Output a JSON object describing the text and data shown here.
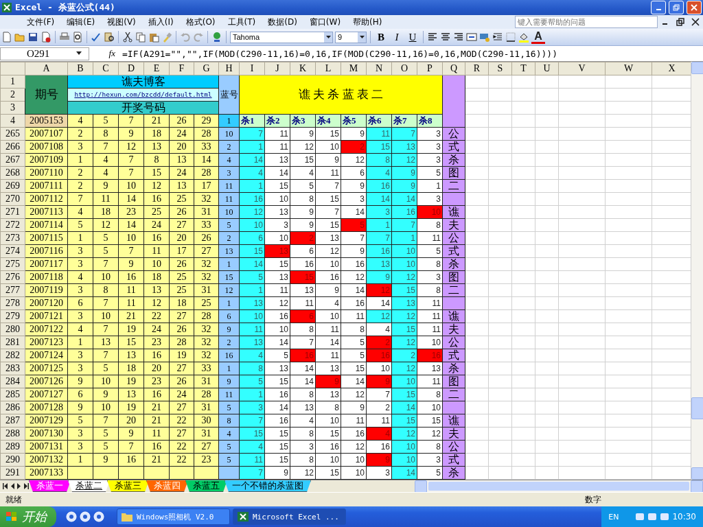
{
  "window": {
    "title": "Excel - 杀蓝公式(44)"
  },
  "menu": [
    "文件(F)",
    "编辑(E)",
    "视图(V)",
    "插入(I)",
    "格式(O)",
    "工具(T)",
    "数据(D)",
    "窗口(W)",
    "帮助(H)"
  ],
  "help_box": {
    "placeholder": "键入需要帮助的问题"
  },
  "toolbar": {
    "font": "Tahoma",
    "size": "9",
    "bold": "B",
    "italic": "I",
    "underline": "U",
    "font_color": "A"
  },
  "formula_bar": {
    "cell": "O291",
    "fx": "fx",
    "formula": "=IF(A291=\"\",\"\",IF(MOD(C290-11,16)=0,16,IF(MOD(C290-11,16)=0,16,MOD(C290-11,16))))"
  },
  "columns": [
    "A",
    "B",
    "C",
    "D",
    "E",
    "F",
    "G",
    "H",
    "I",
    "J",
    "K",
    "L",
    "M",
    "N",
    "O",
    "P",
    "Q",
    "R",
    "S",
    "T",
    "U",
    "V",
    "W",
    "X"
  ],
  "header": {
    "row_labels": [
      "1",
      "2",
      "3",
      "4"
    ],
    "period": "期号",
    "blog": "谯夫博客",
    "link": "http://hexun.com/bzcdd/default.html",
    "draw": "开奖号码",
    "blue": "蓝号",
    "title": "谯 夫 杀 蓝 表 二"
  },
  "row4": {
    "period": "2005153",
    "numbers": [
      "4",
      "5",
      "7",
      "21",
      "26",
      "29"
    ],
    "blue": "1",
    "kills": [
      "杀1",
      "杀2",
      "杀3",
      "杀4",
      "杀5",
      "杀6",
      "杀7",
      "杀8"
    ]
  },
  "rows": [
    {
      "row": "265",
      "period": "2007107",
      "numbers": [
        "2",
        "8",
        "9",
        "18",
        "24",
        "28"
      ],
      "blue": "10",
      "q": "公",
      "kills": [
        {
          "value": "7",
          "color": "#33ffff"
        },
        {
          "value": "11",
          "color": "#ffffff"
        },
        {
          "value": "9",
          "color": "#ffffff"
        },
        {
          "value": "15",
          "color": "#ffffff"
        },
        {
          "value": "9",
          "color": "#ffffff"
        },
        {
          "value": "11",
          "color": "#33ffff"
        },
        {
          "value": "7",
          "color": "#33ffff"
        },
        {
          "value": "3",
          "color": "#ffffff"
        }
      ]
    },
    {
      "row": "266",
      "period": "2007108",
      "numbers": [
        "3",
        "7",
        "12",
        "13",
        "20",
        "33"
      ],
      "blue": "2",
      "q": "式",
      "kills": [
        {
          "value": "1",
          "color": "#33ffff"
        },
        {
          "value": "11",
          "color": "#ffffff"
        },
        {
          "value": "12",
          "color": "#ffffff"
        },
        {
          "value": "10",
          "color": "#ffffff"
        },
        {
          "value": "2",
          "color": "#ff0000"
        },
        {
          "value": "15",
          "color": "#33ffff"
        },
        {
          "value": "13",
          "color": "#33ffff"
        },
        {
          "value": "3",
          "color": "#ffffff"
        }
      ]
    },
    {
      "row": "267",
      "period": "2007109",
      "numbers": [
        "1",
        "4",
        "7",
        "8",
        "13",
        "14"
      ],
      "blue": "4",
      "q": "杀",
      "kills": [
        {
          "value": "14",
          "color": "#33ffff"
        },
        {
          "value": "13",
          "color": "#ffffff"
        },
        {
          "value": "15",
          "color": "#ffffff"
        },
        {
          "value": "9",
          "color": "#ffffff"
        },
        {
          "value": "12",
          "color": "#ffffff"
        },
        {
          "value": "8",
          "color": "#33ffff"
        },
        {
          "value": "12",
          "color": "#33ffff"
        },
        {
          "value": "3",
          "color": "#ffffff"
        }
      ]
    },
    {
      "row": "268",
      "period": "2007110",
      "numbers": [
        "2",
        "4",
        "7",
        "15",
        "24",
        "28"
      ],
      "blue": "3",
      "q": "图",
      "kills": [
        {
          "value": "4",
          "color": "#33ffff"
        },
        {
          "value": "14",
          "color": "#ffffff"
        },
        {
          "value": "4",
          "color": "#ffffff"
        },
        {
          "value": "11",
          "color": "#ffffff"
        },
        {
          "value": "6",
          "color": "#ffffff"
        },
        {
          "value": "4",
          "color": "#33ffff"
        },
        {
          "value": "9",
          "color": "#33ffff"
        },
        {
          "value": "5",
          "color": "#ffffff"
        }
      ]
    },
    {
      "row": "269",
      "period": "2007111",
      "numbers": [
        "2",
        "9",
        "10",
        "12",
        "13",
        "17"
      ],
      "blue": "11",
      "q": "二",
      "kills": [
        {
          "value": "1",
          "color": "#33ffff"
        },
        {
          "value": "15",
          "color": "#ffffff"
        },
        {
          "value": "5",
          "color": "#ffffff"
        },
        {
          "value": "7",
          "color": "#ffffff"
        },
        {
          "value": "9",
          "color": "#ffffff"
        },
        {
          "value": "16",
          "color": "#33ffff"
        },
        {
          "value": "9",
          "color": "#33ffff"
        },
        {
          "value": "1",
          "color": "#ffffff"
        }
      ]
    },
    {
      "row": "270",
      "period": "2007112",
      "numbers": [
        "7",
        "11",
        "14",
        "16",
        "25",
        "32"
      ],
      "blue": "11",
      "kills": [
        {
          "value": "16",
          "color": "#33ffff"
        },
        {
          "value": "10",
          "color": "#ffffff"
        },
        {
          "value": "8",
          "color": "#ffffff"
        },
        {
          "value": "15",
          "color": "#ffffff"
        },
        {
          "value": "3",
          "color": "#ffffff"
        },
        {
          "value": "14",
          "color": "#33ffff"
        },
        {
          "value": "14",
          "color": "#33ffff"
        },
        {
          "value": "3",
          "color": "#ffffff"
        }
      ]
    },
    {
      "row": "271",
      "period": "2007113",
      "numbers": [
        "4",
        "18",
        "23",
        "25",
        "26",
        "31"
      ],
      "blue": "10",
      "q": "谯",
      "kills": [
        {
          "value": "12",
          "color": "#33ffff"
        },
        {
          "value": "13",
          "color": "#ffffff"
        },
        {
          "value": "9",
          "color": "#ffffff"
        },
        {
          "value": "7",
          "color": "#ffffff"
        },
        {
          "value": "14",
          "color": "#ffffff"
        },
        {
          "value": "3",
          "color": "#33ffff"
        },
        {
          "value": "16",
          "color": "#33ffff"
        },
        {
          "value": "10",
          "color": "#ff0000"
        }
      ]
    },
    {
      "row": "272",
      "period": "2007114",
      "numbers": [
        "5",
        "12",
        "14",
        "24",
        "27",
        "33"
      ],
      "blue": "5",
      "q": "夫",
      "kills": [
        {
          "value": "10",
          "color": "#33ffff"
        },
        {
          "value": "3",
          "color": "#ffffff"
        },
        {
          "value": "9",
          "color": "#ffffff"
        },
        {
          "value": "15",
          "color": "#ffffff"
        },
        {
          "value": "5",
          "color": "#ff0000"
        },
        {
          "value": "1",
          "color": "#33ffff"
        },
        {
          "value": "7",
          "color": "#33ffff"
        },
        {
          "value": "8",
          "color": "#ffffff"
        }
      ]
    },
    {
      "row": "273",
      "period": "2007115",
      "numbers": [
        "1",
        "5",
        "10",
        "16",
        "20",
        "26"
      ],
      "blue": "2",
      "q": "公",
      "kills": [
        {
          "value": "6",
          "color": "#33ffff"
        },
        {
          "value": "10",
          "color": "#ffffff"
        },
        {
          "value": "2",
          "color": "#ff0000"
        },
        {
          "value": "13",
          "color": "#ffffff"
        },
        {
          "value": "7",
          "color": "#ffffff"
        },
        {
          "value": "7",
          "color": "#33ffff"
        },
        {
          "value": "1",
          "color": "#33ffff"
        },
        {
          "value": "11",
          "color": "#ffffff"
        }
      ]
    },
    {
      "row": "274",
      "period": "2007116",
      "numbers": [
        "3",
        "5",
        "7",
        "11",
        "17",
        "27"
      ],
      "blue": "13",
      "q": "式",
      "kills": [
        {
          "value": "15",
          "color": "#33ffff"
        },
        {
          "value": "13",
          "color": "#ff0000"
        },
        {
          "value": "6",
          "color": "#ffffff"
        },
        {
          "value": "12",
          "color": "#ffffff"
        },
        {
          "value": "9",
          "color": "#ffffff"
        },
        {
          "value": "16",
          "color": "#33ffff"
        },
        {
          "value": "10",
          "color": "#33ffff"
        },
        {
          "value": "5",
          "color": "#ffffff"
        }
      ]
    },
    {
      "row": "275",
      "period": "2007117",
      "numbers": [
        "3",
        "7",
        "9",
        "10",
        "26",
        "32"
      ],
      "blue": "1",
      "q": "杀",
      "kills": [
        {
          "value": "14",
          "color": "#33ffff"
        },
        {
          "value": "15",
          "color": "#ffffff"
        },
        {
          "value": "16",
          "color": "#ffffff"
        },
        {
          "value": "10",
          "color": "#ffffff"
        },
        {
          "value": "16",
          "color": "#ffffff"
        },
        {
          "value": "13",
          "color": "#33ffff"
        },
        {
          "value": "10",
          "color": "#33ffff"
        },
        {
          "value": "8",
          "color": "#ffffff"
        }
      ]
    },
    {
      "row": "276",
      "period": "2007118",
      "numbers": [
        "4",
        "10",
        "16",
        "18",
        "25",
        "32"
      ],
      "blue": "15",
      "q": "图",
      "kills": [
        {
          "value": "5",
          "color": "#33ffff"
        },
        {
          "value": "13",
          "color": "#ffffff"
        },
        {
          "value": "15",
          "color": "#ff0000"
        },
        {
          "value": "16",
          "color": "#ffffff"
        },
        {
          "value": "12",
          "color": "#ffffff"
        },
        {
          "value": "9",
          "color": "#33ffff"
        },
        {
          "value": "12",
          "color": "#33ffff"
        },
        {
          "value": "3",
          "color": "#ffffff"
        }
      ]
    },
    {
      "row": "277",
      "period": "2007119",
      "numbers": [
        "3",
        "8",
        "11",
        "13",
        "25",
        "31"
      ],
      "blue": "12",
      "q": "二",
      "kills": [
        {
          "value": "1",
          "color": "#33ffff"
        },
        {
          "value": "11",
          "color": "#ffffff"
        },
        {
          "value": "13",
          "color": "#ffffff"
        },
        {
          "value": "9",
          "color": "#ffffff"
        },
        {
          "value": "14",
          "color": "#ffffff"
        },
        {
          "value": "12",
          "color": "#ff0000"
        },
        {
          "value": "15",
          "color": "#33ffff"
        },
        {
          "value": "8",
          "color": "#ffffff"
        }
      ]
    },
    {
      "row": "278",
      "period": "2007120",
      "numbers": [
        "6",
        "7",
        "11",
        "12",
        "18",
        "25"
      ],
      "blue": "1",
      "kills": [
        {
          "value": "13",
          "color": "#33ffff"
        },
        {
          "value": "12",
          "color": "#ffffff"
        },
        {
          "value": "11",
          "color": "#ffffff"
        },
        {
          "value": "4",
          "color": "#ffffff"
        },
        {
          "value": "16",
          "color": "#ffffff"
        },
        {
          "value": "14",
          "color": "#ffffff"
        },
        {
          "value": "13",
          "color": "#33ffff"
        },
        {
          "value": "11",
          "color": "#ffffff"
        }
      ]
    },
    {
      "row": "279",
      "period": "2007121",
      "numbers": [
        "3",
        "10",
        "21",
        "22",
        "27",
        "28"
      ],
      "blue": "6",
      "q": "谯",
      "kills": [
        {
          "value": "10",
          "color": "#33ffff"
        },
        {
          "value": "16",
          "color": "#ffffff"
        },
        {
          "value": "6",
          "color": "#ff0000"
        },
        {
          "value": "10",
          "color": "#ffffff"
        },
        {
          "value": "11",
          "color": "#ffffff"
        },
        {
          "value": "12",
          "color": "#33ffff"
        },
        {
          "value": "12",
          "color": "#33ffff"
        },
        {
          "value": "11",
          "color": "#ffffff"
        }
      ]
    },
    {
      "row": "280",
      "period": "2007122",
      "numbers": [
        "4",
        "7",
        "19",
        "24",
        "26",
        "32"
      ],
      "blue": "9",
      "q": "夫",
      "kills": [
        {
          "value": "11",
          "color": "#33ffff"
        },
        {
          "value": "10",
          "color": "#ffffff"
        },
        {
          "value": "8",
          "color": "#ffffff"
        },
        {
          "value": "11",
          "color": "#ffffff"
        },
        {
          "value": "8",
          "color": "#ffffff"
        },
        {
          "value": "4",
          "color": "#ffffff"
        },
        {
          "value": "15",
          "color": "#33ffff"
        },
        {
          "value": "11",
          "color": "#ffffff"
        }
      ]
    },
    {
      "row": "281",
      "period": "2007123",
      "numbers": [
        "1",
        "13",
        "15",
        "23",
        "28",
        "32"
      ],
      "blue": "2",
      "q": "公",
      "kills": [
        {
          "value": "13",
          "color": "#33ffff"
        },
        {
          "value": "14",
          "color": "#ffffff"
        },
        {
          "value": "7",
          "color": "#ffffff"
        },
        {
          "value": "14",
          "color": "#ffffff"
        },
        {
          "value": "5",
          "color": "#ffffff"
        },
        {
          "value": "2",
          "color": "#ff0000"
        },
        {
          "value": "12",
          "color": "#33ffff"
        },
        {
          "value": "10",
          "color": "#ffffff"
        }
      ]
    },
    {
      "row": "282",
      "period": "2007124",
      "numbers": [
        "3",
        "7",
        "13",
        "16",
        "19",
        "32"
      ],
      "blue": "16",
      "q": "式",
      "kills": [
        {
          "value": "4",
          "color": "#33ffff"
        },
        {
          "value": "5",
          "color": "#ffffff"
        },
        {
          "value": "16",
          "color": "#ff0000"
        },
        {
          "value": "11",
          "color": "#ffffff"
        },
        {
          "value": "5",
          "color": "#ffffff"
        },
        {
          "value": "16",
          "color": "#ff0000"
        },
        {
          "value": "2",
          "color": "#33ffff"
        },
        {
          "value": "16",
          "color": "#ff0000"
        }
      ]
    },
    {
      "row": "283",
      "period": "2007125",
      "numbers": [
        "3",
        "5",
        "18",
        "20",
        "27",
        "33"
      ],
      "blue": "1",
      "q": "杀",
      "kills": [
        {
          "value": "8",
          "color": "#33ffff"
        },
        {
          "value": "13",
          "color": "#ffffff"
        },
        {
          "value": "14",
          "color": "#ffffff"
        },
        {
          "value": "13",
          "color": "#ffffff"
        },
        {
          "value": "15",
          "color": "#ffffff"
        },
        {
          "value": "10",
          "color": "#ffffff"
        },
        {
          "value": "12",
          "color": "#33ffff"
        },
        {
          "value": "13",
          "color": "#ffffff"
        }
      ]
    },
    {
      "row": "284",
      "period": "2007126",
      "numbers": [
        "9",
        "10",
        "19",
        "23",
        "26",
        "31"
      ],
      "blue": "9",
      "q": "图",
      "kills": [
        {
          "value": "5",
          "color": "#33ffff"
        },
        {
          "value": "15",
          "color": "#ffffff"
        },
        {
          "value": "14",
          "color": "#ffffff"
        },
        {
          "value": "9",
          "color": "#ff0000"
        },
        {
          "value": "14",
          "color": "#ffffff"
        },
        {
          "value": "9",
          "color": "#ff0000"
        },
        {
          "value": "10",
          "color": "#33ffff"
        },
        {
          "value": "11",
          "color": "#ffffff"
        }
      ]
    },
    {
      "row": "285",
      "period": "2007127",
      "numbers": [
        "6",
        "9",
        "13",
        "16",
        "24",
        "28"
      ],
      "blue": "11",
      "q": "二",
      "kills": [
        {
          "value": "1",
          "color": "#33ffff"
        },
        {
          "value": "16",
          "color": "#ffffff"
        },
        {
          "value": "8",
          "color": "#ffffff"
        },
        {
          "value": "13",
          "color": "#ffffff"
        },
        {
          "value": "12",
          "color": "#ffffff"
        },
        {
          "value": "7",
          "color": "#ffffff"
        },
        {
          "value": "15",
          "color": "#33ffff"
        },
        {
          "value": "8",
          "color": "#ffffff"
        }
      ]
    },
    {
      "row": "286",
      "period": "2007128",
      "numbers": [
        "9",
        "10",
        "19",
        "21",
        "27",
        "31"
      ],
      "blue": "5",
      "kills": [
        {
          "value": "3",
          "color": "#33ffff"
        },
        {
          "value": "14",
          "color": "#ffffff"
        },
        {
          "value": "13",
          "color": "#ffffff"
        },
        {
          "value": "8",
          "color": "#ffffff"
        },
        {
          "value": "9",
          "color": "#ffffff"
        },
        {
          "value": "2",
          "color": "#ffffff"
        },
        {
          "value": "14",
          "color": "#33ffff"
        },
        {
          "value": "10",
          "color": "#ffffff"
        }
      ]
    },
    {
      "row": "287",
      "period": "2007129",
      "numbers": [
        "5",
        "7",
        "20",
        "21",
        "22",
        "30"
      ],
      "blue": "8",
      "q": "谯",
      "kills": [
        {
          "value": "7",
          "color": "#33ffff"
        },
        {
          "value": "16",
          "color": "#ffffff"
        },
        {
          "value": "4",
          "color": "#ffffff"
        },
        {
          "value": "10",
          "color": "#ffffff"
        },
        {
          "value": "11",
          "color": "#ffffff"
        },
        {
          "value": "11",
          "color": "#ffffff"
        },
        {
          "value": "15",
          "color": "#33ffff"
        },
        {
          "value": "15",
          "color": "#ffffff"
        }
      ]
    },
    {
      "row": "288",
      "period": "2007130",
      "numbers": [
        "3",
        "5",
        "9",
        "11",
        "27",
        "31"
      ],
      "blue": "4",
      "q": "夫",
      "kills": [
        {
          "value": "15",
          "color": "#33ffff"
        },
        {
          "value": "15",
          "color": "#ffffff"
        },
        {
          "value": "8",
          "color": "#ffffff"
        },
        {
          "value": "15",
          "color": "#ffffff"
        },
        {
          "value": "16",
          "color": "#ffffff"
        },
        {
          "value": "4",
          "color": "#ff0000"
        },
        {
          "value": "12",
          "color": "#33ffff"
        },
        {
          "value": "12",
          "color": "#ffffff"
        }
      ]
    },
    {
      "row": "289",
      "period": "2007131",
      "numbers": [
        "3",
        "5",
        "7",
        "16",
        "22",
        "27"
      ],
      "blue": "5",
      "q": "公",
      "kills": [
        {
          "value": "4",
          "color": "#33ffff"
        },
        {
          "value": "15",
          "color": "#ffffff"
        },
        {
          "value": "3",
          "color": "#ffffff"
        },
        {
          "value": "16",
          "color": "#ffffff"
        },
        {
          "value": "12",
          "color": "#ffffff"
        },
        {
          "value": "16",
          "color": "#ffffff"
        },
        {
          "value": "10",
          "color": "#33ffff"
        },
        {
          "value": "8",
          "color": "#ffffff"
        }
      ]
    },
    {
      "row": "290",
      "period": "2007132",
      "numbers": [
        "1",
        "9",
        "16",
        "21",
        "22",
        "23"
      ],
      "blue": "5",
      "q": "式",
      "kills": [
        {
          "value": "11",
          "color": "#33ffff"
        },
        {
          "value": "15",
          "color": "#ffffff"
        },
        {
          "value": "8",
          "color": "#ffffff"
        },
        {
          "value": "10",
          "color": "#ffffff"
        },
        {
          "value": "10",
          "color": "#ffffff"
        },
        {
          "value": "9",
          "color": "#ff0000"
        },
        {
          "value": "10",
          "color": "#33ffff"
        },
        {
          "value": "3",
          "color": "#ffffff"
        }
      ]
    },
    {
      "row": "291",
      "period": "2007133",
      "q": "杀",
      "kills": [
        {
          "value": "7",
          "color": "#33ffff"
        },
        {
          "value": "9",
          "color": "#ffffff"
        },
        {
          "value": "12",
          "color": "#ffffff"
        },
        {
          "value": "15",
          "color": "#ffffff"
        },
        {
          "value": "10",
          "color": "#ffffff"
        },
        {
          "value": "3",
          "color": "#ffffff"
        },
        {
          "value": "14",
          "color": "#33ffff"
        },
        {
          "value": "5",
          "color": "#ffffff"
        }
      ]
    }
  ],
  "sheet_tabs": [
    {
      "label": "杀蓝一",
      "selected": false,
      "color": "#ff00ff"
    },
    {
      "label": "杀蓝二",
      "selected": true,
      "color": "#ffffff"
    },
    {
      "label": "杀蓝三",
      "selected": false,
      "color": "#ffff00"
    },
    {
      "label": "杀蓝四",
      "selected": false,
      "color": "#ff6600"
    },
    {
      "label": "杀蓝五",
      "selected": false,
      "color": "#00cc66"
    },
    {
      "label": "一个不错的杀蓝图",
      "selected": false,
      "color": "#33ccff"
    }
  ],
  "status": {
    "text": "就绪",
    "mode": "数字"
  },
  "taskbar": {
    "start": "开始",
    "tasks": [
      {
        "label": "Windows照相机 V2.0",
        "selected": false
      },
      {
        "label": "Microsoft Excel ...",
        "selected": true
      }
    ],
    "lang": "EN",
    "clock": "10:30"
  }
}
